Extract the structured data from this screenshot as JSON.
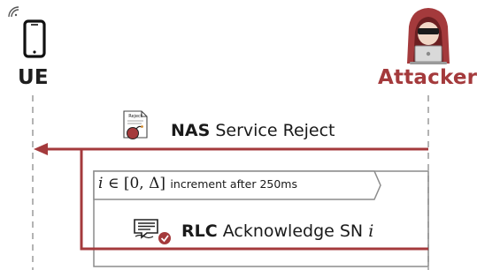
{
  "actors": {
    "ue": {
      "label": "UE",
      "color": "#1f1f1f",
      "icon": "smartphone-icon"
    },
    "attacker": {
      "label": "Attacker",
      "color": "#a43a3c",
      "icon": "hacker-with-laptop-icon"
    }
  },
  "messages": [
    {
      "id": "nas-service-reject",
      "from": "attacker",
      "to": "ue",
      "bold": "NAS",
      "text": "Service Reject",
      "icon": "reject-document-bomb-icon",
      "icon_text": "Reject"
    },
    {
      "id": "rlc-acknowledge",
      "from": "attacker",
      "to": "ue",
      "bold": "RLC",
      "text": "Acknowledge SN",
      "var": "i",
      "icon": "acknowledge-document-check-icon"
    }
  ],
  "loop": {
    "condition_var": "i",
    "condition_op": "∈",
    "condition_range": "[0, Δ]",
    "note": "increment after 250ms"
  },
  "colors": {
    "arrow": "#a43a3c",
    "lifeline": "#9a9a9a",
    "frame": "#8c8c8c"
  }
}
